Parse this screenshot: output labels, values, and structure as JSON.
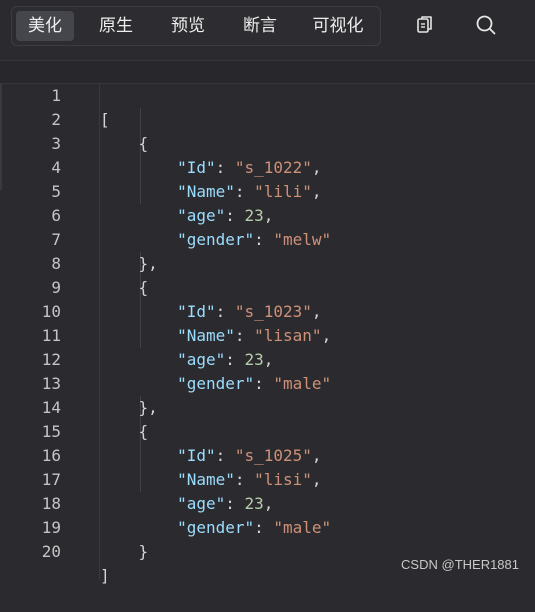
{
  "toolbar": {
    "tabs": [
      {
        "label": "美化",
        "active": true
      },
      {
        "label": "原生",
        "active": false
      },
      {
        "label": "预览",
        "active": false
      },
      {
        "label": "断言",
        "active": false
      },
      {
        "label": "可视化",
        "active": false
      }
    ],
    "icons": [
      "copy-icon",
      "search-icon"
    ]
  },
  "editor": {
    "line_numbers": [
      "1",
      "2",
      "3",
      "4",
      "5",
      "6",
      "7",
      "8",
      "9",
      "10",
      "11",
      "12",
      "13",
      "14",
      "15",
      "16",
      "17",
      "18",
      "19",
      "20"
    ],
    "records": [
      {
        "Id": "s_1022",
        "Name": "lili",
        "age": "23",
        "gender": "melw"
      },
      {
        "Id": "s_1023",
        "Name": "lisan",
        "age": "23",
        "gender": "male"
      },
      {
        "Id": "s_1025",
        "Name": "lisi",
        "age": "23",
        "gender": "male"
      }
    ],
    "keys": {
      "id": "\"Id\"",
      "name": "\"Name\"",
      "age": "\"age\"",
      "gender": "\"gender\""
    },
    "values": {
      "r1_id": "\"s_1022\"",
      "r1_name": "\"lili\"",
      "r1_age": "23",
      "r1_gender": "\"melw\"",
      "r2_id": "\"s_1023\"",
      "r2_name": "\"lisan\"",
      "r2_age": "23",
      "r2_gender": "\"male\"",
      "r3_id": "\"s_1025\"",
      "r3_name": "\"lisi\"",
      "r3_age": "23",
      "r3_gender": "\"male\""
    }
  },
  "watermark": "CSDN @THER1881",
  "colors": {
    "background": "#2b2b2f",
    "key": "#9cdcfe",
    "string": "#ce9178",
    "number": "#b5cea8",
    "punctuation": "#d4d4d4"
  }
}
